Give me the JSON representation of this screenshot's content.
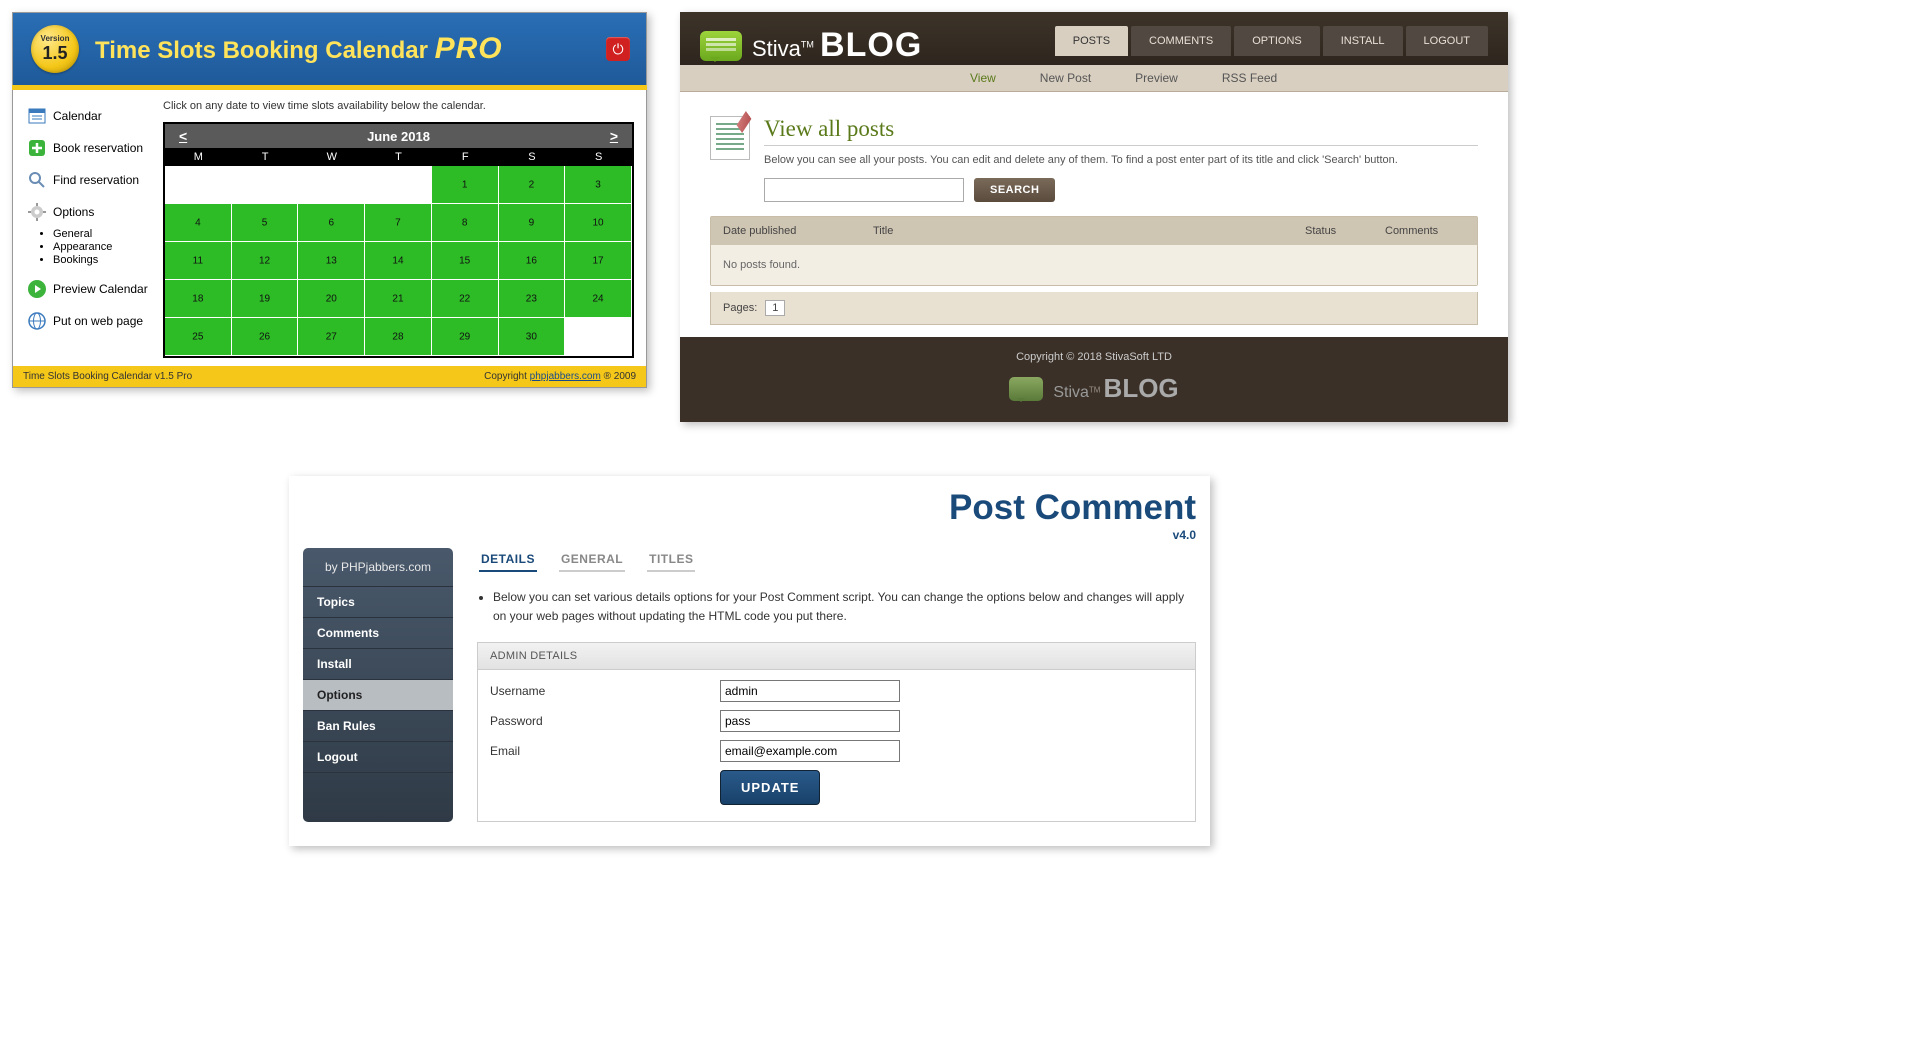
{
  "panel1": {
    "badge": {
      "version_label": "Version",
      "version_num": "1.5"
    },
    "title_main": "Time Slots Booking Calendar",
    "title_pro": "PRO",
    "hint": "Click on any date to view time slots availability below the calendar.",
    "month": "June 2018",
    "prev": "<",
    "next": ">",
    "dow": [
      "M",
      "T",
      "W",
      "T",
      "F",
      "S",
      "S"
    ],
    "days": [
      {
        "n": "",
        "e": true
      },
      {
        "n": "",
        "e": true
      },
      {
        "n": "",
        "e": true
      },
      {
        "n": "",
        "e": true
      },
      {
        "n": "1"
      },
      {
        "n": "2"
      },
      {
        "n": "3"
      },
      {
        "n": "4"
      },
      {
        "n": "5"
      },
      {
        "n": "6"
      },
      {
        "n": "7"
      },
      {
        "n": "8"
      },
      {
        "n": "9"
      },
      {
        "n": "10"
      },
      {
        "n": "11"
      },
      {
        "n": "12"
      },
      {
        "n": "13"
      },
      {
        "n": "14"
      },
      {
        "n": "15"
      },
      {
        "n": "16"
      },
      {
        "n": "17"
      },
      {
        "n": "18"
      },
      {
        "n": "19"
      },
      {
        "n": "20"
      },
      {
        "n": "21"
      },
      {
        "n": "22"
      },
      {
        "n": "23"
      },
      {
        "n": "24"
      },
      {
        "n": "25"
      },
      {
        "n": "26"
      },
      {
        "n": "27"
      },
      {
        "n": "28"
      },
      {
        "n": "29"
      },
      {
        "n": "30"
      },
      {
        "n": "",
        "e": true
      }
    ],
    "nav": {
      "calendar": "Calendar",
      "book": "Book reservation",
      "find": "Find reservation",
      "options": "Options",
      "general": "General",
      "appearance": "Appearance",
      "bookings": "Bookings",
      "preview": "Preview Calendar",
      "put": "Put on web page"
    },
    "footer_left": "Time Slots Booking Calendar v1.5 Pro",
    "footer_right_pre": "Copyright ",
    "footer_link": "phpjabbers.com",
    "footer_right_post": " ® 2009"
  },
  "panel2": {
    "logo_stiva": "Stiva",
    "logo_tm": "TM",
    "logo_blog": "BLOG",
    "tabs": [
      "POSTS",
      "COMMENTS",
      "OPTIONS",
      "INSTALL",
      "LOGOUT"
    ],
    "subnav": [
      "View",
      "New Post",
      "Preview",
      "RSS Feed"
    ],
    "heading": "View all posts",
    "desc": "Below you can see all your posts. You can edit and delete any of them. To find a post enter part of its title and click 'Search' button.",
    "search_btn": "SEARCH",
    "columns": [
      "Date published",
      "Title",
      "Status",
      "Comments"
    ],
    "empty": "No posts found.",
    "pages_label": "Pages:",
    "page_num": "1",
    "copyright": "Copyright © 2018 StivaSoft LTD"
  },
  "panel3": {
    "title": "Post Comment",
    "version": "v4.0",
    "side_head": "by PHPjabbers.com",
    "side": [
      "Topics",
      "Comments",
      "Install",
      "Options",
      "Ban Rules",
      "Logout"
    ],
    "tabs": [
      "DETAILS",
      "GENERAL",
      "TITLES"
    ],
    "bullet": "Below you can set various details options for your Post Comment script. You can change the options below and changes will apply on your web pages without updating the HTML code you put there.",
    "box_head": "ADMIN DETAILS",
    "fields": {
      "username_label": "Username",
      "username_val": "admin",
      "password_label": "Password",
      "password_val": "pass",
      "email_label": "Email",
      "email_val": "email@example.com"
    },
    "update": "UPDATE"
  }
}
